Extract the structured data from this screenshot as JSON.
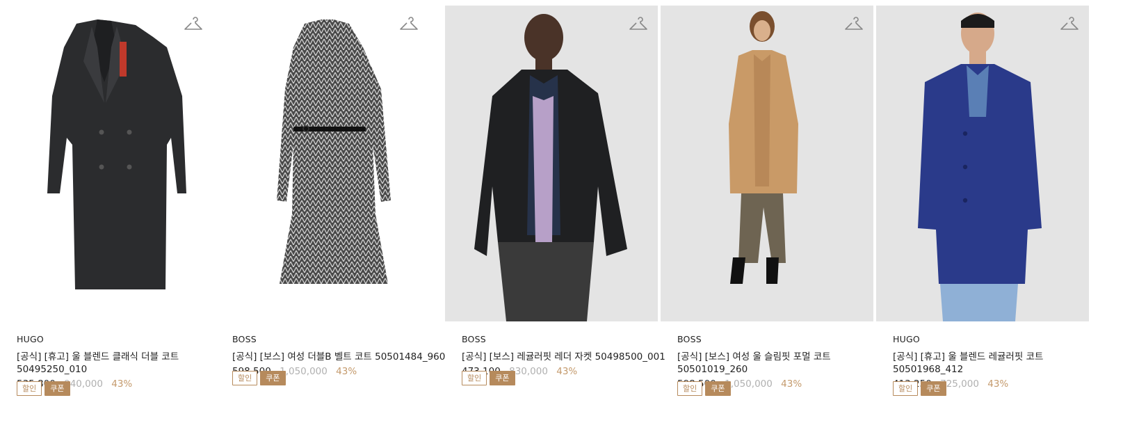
{
  "products": [
    {
      "brand": "HUGO",
      "title": "[공식] [휴고] 울 블렌드 클래식 더블 코트 50495250_010",
      "price": "535,800",
      "original_price": "940,000",
      "discount_rate": "43%",
      "badges": {
        "discount": "할인",
        "coupon": "쿠폰"
      },
      "image": "dark-charcoal-double-breasted-wool-coat",
      "background": "white"
    },
    {
      "brand": "BOSS",
      "title": "[공식] [보스] 여성 더블B 벨트 코트 50501484_960",
      "price": "598,500",
      "original_price": "1,050,000",
      "discount_rate": "43%",
      "badges": {
        "discount": "할인",
        "coupon": "쿠폰"
      },
      "image": "herringbone-belted-coat",
      "background": "white"
    },
    {
      "brand": "BOSS",
      "title": "[공식] [보스] 레귤러핏 레더 자켓 50498500_001",
      "price": "473,100",
      "original_price": "830,000",
      "discount_rate": "43%",
      "badges": {
        "discount": "할인",
        "coupon": "쿠폰"
      },
      "image": "model-black-leather-jacket",
      "background": "gray"
    },
    {
      "brand": "BOSS",
      "title": "[공식] [보스] 여성 울 슬림핏 포멀 코트 50501019_260",
      "price": "598,500",
      "original_price": "1,050,000",
      "discount_rate": "43%",
      "badges": {
        "discount": "할인",
        "coupon": "쿠폰"
      },
      "image": "model-camel-formal-coat",
      "background": "gray"
    },
    {
      "brand": "HUGO",
      "title": "[공식] [휴고] 울 블렌드 레귤러핏 코트 50501968_412",
      "price": "413,250",
      "original_price": "725,000",
      "discount_rate": "43%",
      "badges": {
        "discount": "할인",
        "coupon": "쿠폰"
      },
      "image": "model-navy-wool-coat",
      "background": "gray"
    }
  ],
  "icons": {
    "wishlist": "hanger-icon"
  },
  "colors": {
    "accent": "#b68a5c",
    "discount_text": "#c49a6c",
    "original_price": "#b0b0b0"
  }
}
